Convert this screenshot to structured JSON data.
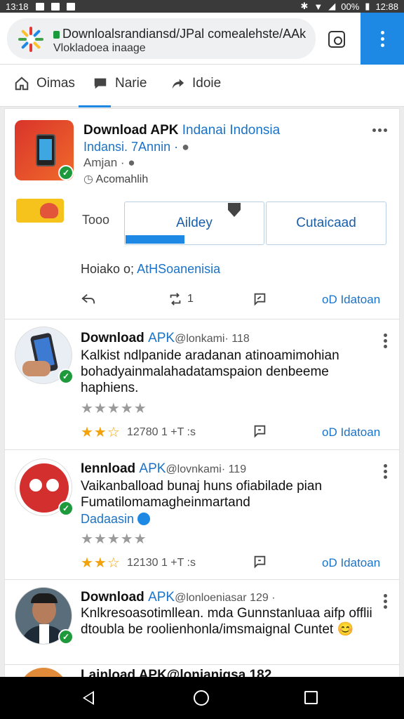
{
  "status_bar": {
    "left_time": "13:18",
    "battery": "00%",
    "right_time": "12:88"
  },
  "browser": {
    "url": "Downloalsrandiansd/JPal comealehste/AAk",
    "page_subtitle": "Vlokladoea inaage"
  },
  "nav_tabs": [
    {
      "label": "Oimas",
      "icon": "home-icon"
    },
    {
      "label": "Narie",
      "icon": "comment-icon"
    },
    {
      "label": "Idoie",
      "icon": "share-arrow-icon"
    }
  ],
  "featured": {
    "title_bold": "Download APK",
    "title_blue": "Indanai Indonsia",
    "subtitle": "Indansi. 7Annin ·",
    "meta": "Amjan ·",
    "time": "Acomahlih",
    "left_label": "Tooo",
    "button_primary": "Aildey",
    "button_secondary": "Cutaicaad",
    "footer_prefix": "Hoiako o;",
    "footer_link": "AtHSoanenisia",
    "action_count": "1",
    "action_link": "oD Idatoan"
  },
  "posts": [
    {
      "title_bold": "Download",
      "title_blue": "APK",
      "title_rest": "@lonkami· 118",
      "text": "Kalkist ndlpanide aradanan atinoamimohian bohadyainmalahadatamspaion denbeeme haphiens.",
      "rating_gray": "★★★★★",
      "rating_gold": "★★☆",
      "rating_count": "12780 1 +T :s",
      "action_link": "oD Idatoan"
    },
    {
      "title_bold": "Iennload",
      "title_blue": "APK",
      "title_rest": "@lovnkami· 119",
      "text": "Vaikanbalload bunaj huns ofiabilade pian Fumatilomamagheinmartand",
      "tag": "Dadaasin",
      "rating_gray": "★★★★★",
      "rating_gold": "★★☆",
      "rating_count": "12130 1 +T :s",
      "action_link": "oD Idatoan"
    },
    {
      "title_bold": "Download",
      "title_blue": "APK",
      "title_rest": "@lonloeniasar 129 ·",
      "text": "Knlkresoasotimllean. mda Gunnstanluaa aifp offlii dtoubla be roolienhonla/imsmaignal Cuntet",
      "emoji": "😊"
    }
  ],
  "partial_post": {
    "title": "Lainload APK@lonianigsa 182"
  },
  "colors": {
    "accent": "#1e88e5",
    "link": "#1a73c8",
    "verified": "#1e9a3c",
    "star": "#f2a30b"
  }
}
